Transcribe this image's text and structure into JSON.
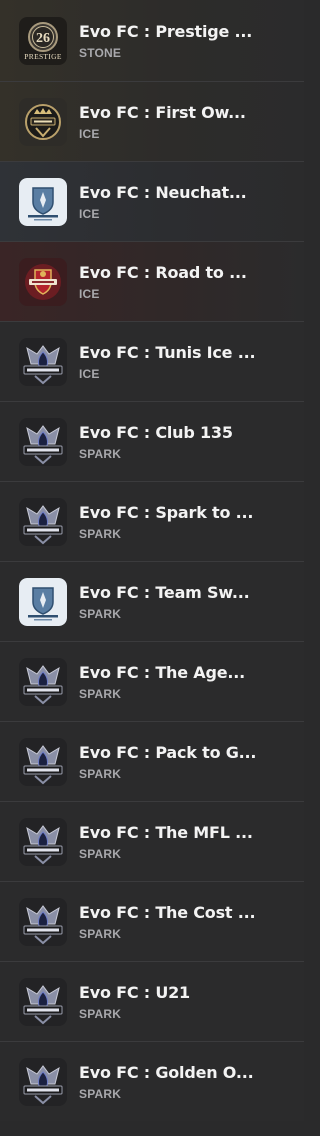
{
  "items": [
    {
      "title": "Evo FC : Prestige ...",
      "tier": "STONE",
      "icon": "prestige-26-badge",
      "icon_text": "26",
      "icon_sub": "PRESTIGE"
    },
    {
      "title": "Evo FC : First Ow...",
      "tier": "ICE",
      "icon": "first-owner-badge"
    },
    {
      "title": "Evo FC : Neuchat...",
      "tier": "ICE",
      "icon": "team-sweat-badge"
    },
    {
      "title": "Evo FC : Road to ...",
      "tier": "ICE",
      "icon": "road-to-shield-badge"
    },
    {
      "title": "Evo FC : Tunis Ice ...",
      "tier": "ICE",
      "icon": "nepenthez-crest-badge"
    },
    {
      "title": "Evo FC : Club 135",
      "tier": "SPARK",
      "icon": "nepenthez-crest-badge"
    },
    {
      "title": "Evo FC : Spark to ...",
      "tier": "SPARK",
      "icon": "nepenthez-crest-badge"
    },
    {
      "title": "Evo FC : Team Sw...",
      "tier": "SPARK",
      "icon": "team-sweat-badge"
    },
    {
      "title": "Evo FC : The Age...",
      "tier": "SPARK",
      "icon": "nepenthez-crest-badge"
    },
    {
      "title": "Evo FC : Pack to G...",
      "tier": "SPARK",
      "icon": "nepenthez-crest-badge"
    },
    {
      "title": "Evo FC : The MFL ...",
      "tier": "SPARK",
      "icon": "nepenthez-crest-badge"
    },
    {
      "title": "Evo FC : The Cost ...",
      "tier": "SPARK",
      "icon": "nepenthez-crest-badge"
    },
    {
      "title": "Evo FC : U21",
      "tier": "SPARK",
      "icon": "nepenthez-crest-badge"
    },
    {
      "title": "Evo FC : Golden O...",
      "tier": "SPARK",
      "icon": "nepenthez-crest-badge"
    }
  ],
  "colors": {
    "background": "#2b2b2c",
    "divider": "#3b3b3d",
    "title": "#f3f3f3",
    "tier": "#a9a9ad"
  }
}
